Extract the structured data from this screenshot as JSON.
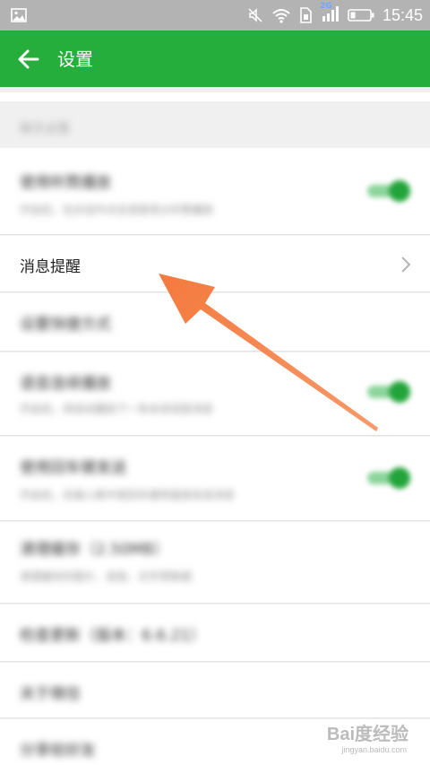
{
  "status_bar": {
    "time": "15:45",
    "network_label": "2G",
    "icons": [
      "gallery-icon",
      "mute-icon",
      "wifi-icon",
      "sim-icon",
      "signal-icon",
      "battery-icon"
    ]
  },
  "app_bar": {
    "title": "设置",
    "back_icon": "arrow-left-icon"
  },
  "settings": {
    "section_header": "聊天设置",
    "items": [
      {
        "title": "使用听筒播放",
        "subtitle": "开启后，在对话中点击语音将从听筒播放",
        "control": "toggle",
        "state": "on",
        "blurred": true
      },
      {
        "title": "消息提醒",
        "subtitle": "",
        "control": "chevron",
        "blurred": false
      },
      {
        "title": "设置快捷方式",
        "subtitle": "",
        "control": "none",
        "blurred": true
      },
      {
        "title": "语音连续播放",
        "subtitle": "开启后，将自动播放下一条未读语音消息",
        "control": "toggle",
        "state": "on",
        "blurred": true
      },
      {
        "title": "使用回车键发送",
        "subtitle": "开启后，在输入框中按回车键将直接发送消息",
        "control": "toggle",
        "state": "on",
        "blurred": true
      },
      {
        "title": "清理缓存（2.50MB）",
        "subtitle": "清理缓存的图片、语音、文件等数据",
        "control": "none",
        "blurred": true
      },
      {
        "title": "检查更新（版本：6.6.21）",
        "subtitle": "",
        "control": "none",
        "blurred": true
      },
      {
        "title": "关于微信",
        "subtitle": "",
        "control": "none",
        "blurred": true
      },
      {
        "title": "分享给好友",
        "subtitle": "",
        "control": "none",
        "blurred": true
      }
    ]
  },
  "annotation": {
    "arrow_color": "#f5874f"
  },
  "watermark": {
    "text": "Bai度经验",
    "sub": "jingyan.baidu.com"
  }
}
